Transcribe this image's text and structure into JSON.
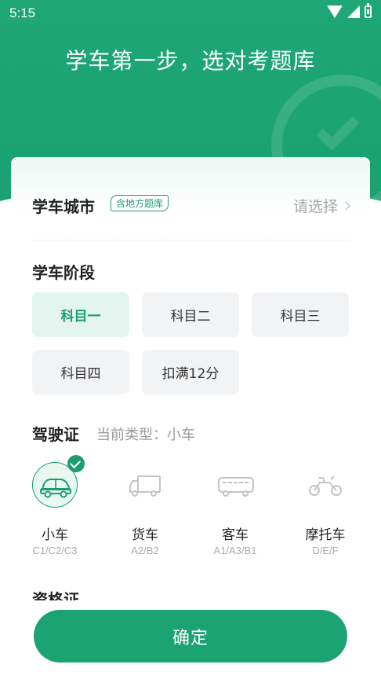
{
  "status_bar": {
    "time": "5:15",
    "icons": [
      "wifi-icon",
      "signal-icon",
      "battery-icon"
    ]
  },
  "header": {
    "headline": "学车第一步，选对考题库"
  },
  "city": {
    "title": "学车城市",
    "tag": "含地方题库",
    "placeholder": "请选择"
  },
  "stage": {
    "title": "学车阶段",
    "options": [
      {
        "label": "科目一",
        "selected": true
      },
      {
        "label": "科目二",
        "selected": false
      },
      {
        "label": "科目三",
        "selected": false
      },
      {
        "label": "科目四",
        "selected": false
      },
      {
        "label": "扣满12分",
        "selected": false
      }
    ]
  },
  "license": {
    "title": "驾驶证",
    "current_type": "当前类型：小车",
    "vehicles": [
      {
        "name": "小车",
        "classes": "C1/C2/C3",
        "icon": "car-icon",
        "selected": true
      },
      {
        "name": "货车",
        "classes": "A2/B2",
        "icon": "truck-icon",
        "selected": false
      },
      {
        "name": "客车",
        "classes": "A1/A3/B1",
        "icon": "bus-icon",
        "selected": false
      },
      {
        "name": "摩托车",
        "classes": "D/E/F",
        "icon": "motorcycle-icon",
        "selected": false
      }
    ]
  },
  "next_section": {
    "title": "资格证"
  },
  "footer": {
    "confirm_label": "确定"
  },
  "colors": {
    "brand": "#1ba371",
    "selected_bg": "#e3f5ee",
    "option_bg": "#f2f3f5"
  }
}
